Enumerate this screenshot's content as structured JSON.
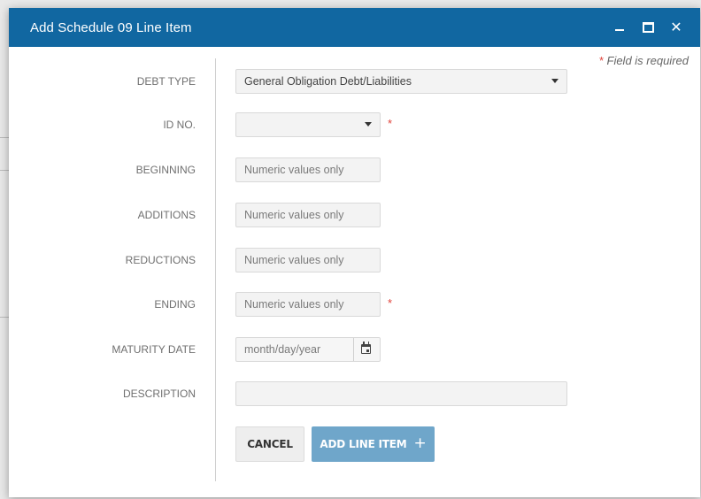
{
  "dialog": {
    "title": "Add Schedule 09 Line Item",
    "required_note": "Field is required",
    "required_star": "*"
  },
  "fields": {
    "debt_type": {
      "label": "DEBT TYPE",
      "value": "General Obligation Debt/Liabilities"
    },
    "id_no": {
      "label": "ID NO.",
      "value": ""
    },
    "beginning": {
      "label": "BEGINNING",
      "placeholder": "Numeric values only"
    },
    "additions": {
      "label": "ADDITIONS",
      "placeholder": "Numeric values only"
    },
    "reductions": {
      "label": "REDUCTIONS",
      "placeholder": "Numeric values only"
    },
    "ending": {
      "label": "ENDING",
      "placeholder": "Numeric values only"
    },
    "maturity_date": {
      "label": "MATURITY DATE",
      "placeholder": "month/day/year"
    },
    "description": {
      "label": "DESCRIPTION",
      "value": ""
    }
  },
  "buttons": {
    "cancel": "CANCEL",
    "add": "ADD LINE ITEM",
    "add_icon": "+"
  },
  "colors": {
    "titlebar": "#1167a1",
    "add_button": "#6fa6ca",
    "required": "#e0433b"
  }
}
